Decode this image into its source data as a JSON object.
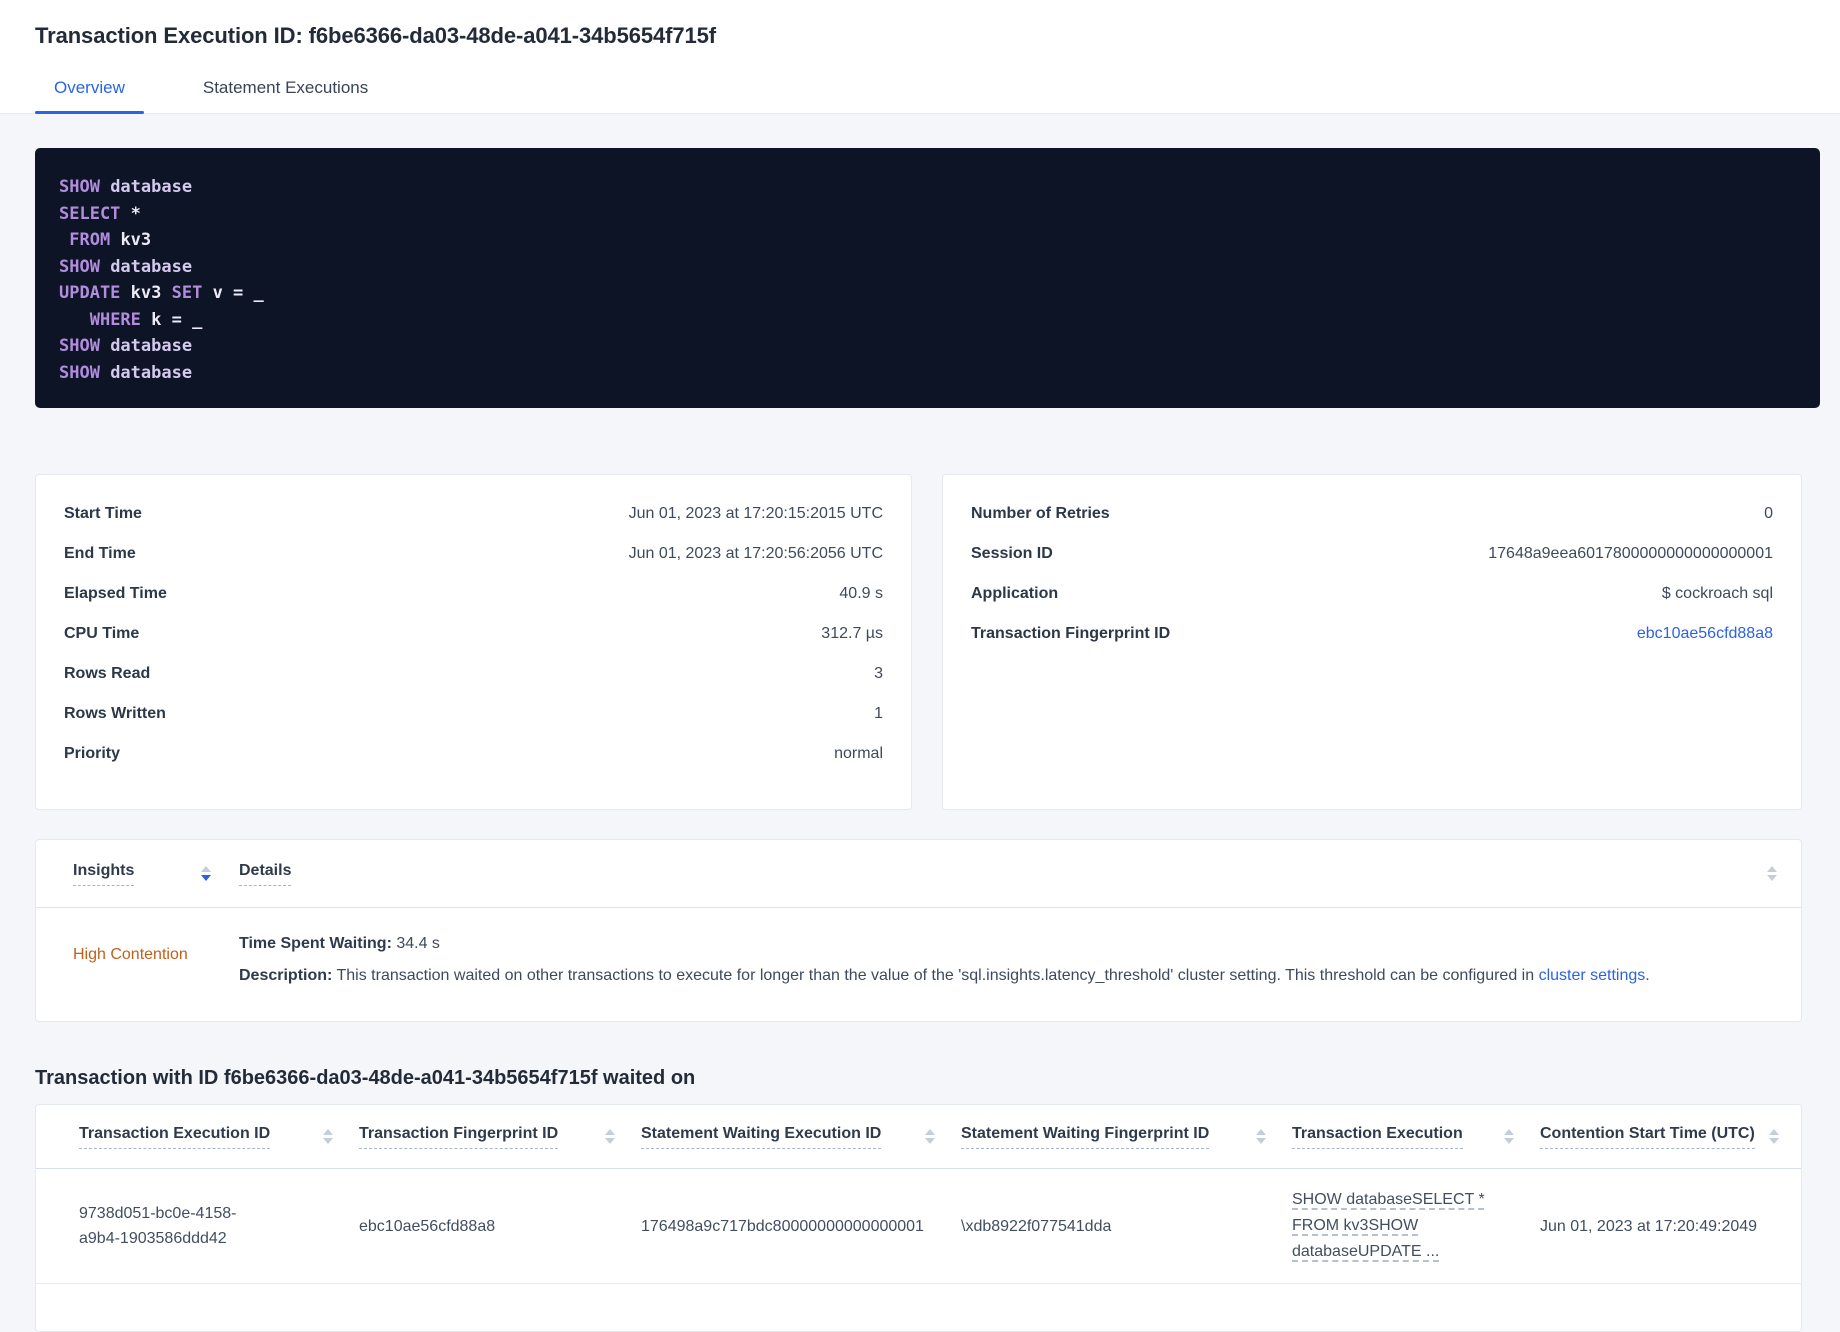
{
  "page": {
    "title": "Transaction Execution ID: f6be6366-da03-48de-a041-34b5654f715f"
  },
  "tabs": {
    "overview": "Overview",
    "statement_executions": "Statement Executions"
  },
  "sql": {
    "lines": [
      [
        {
          "c": "kw",
          "v": "SHOW"
        },
        {
          "c": "pl",
          "v": " database"
        }
      ],
      [
        {
          "c": "kw",
          "v": "SELECT"
        },
        {
          "c": "wh",
          "v": " *"
        }
      ],
      [
        {
          "c": "wh",
          "v": " "
        },
        {
          "c": "kw",
          "v": "FROM"
        },
        {
          "c": "wh",
          "v": " kv3"
        }
      ],
      [
        {
          "c": "kw",
          "v": "SHOW"
        },
        {
          "c": "pl",
          "v": " database"
        }
      ],
      [
        {
          "c": "kw",
          "v": "UPDATE"
        },
        {
          "c": "wh",
          "v": " kv3 "
        },
        {
          "c": "kw",
          "v": "SET"
        },
        {
          "c": "wh",
          "v": " v = _"
        }
      ],
      [
        {
          "c": "wh",
          "v": "   "
        },
        {
          "c": "kw",
          "v": "WHERE"
        },
        {
          "c": "wh",
          "v": " k = _"
        }
      ],
      [
        {
          "c": "kw",
          "v": "SHOW"
        },
        {
          "c": "pl",
          "v": " database"
        }
      ],
      [
        {
          "c": "kw",
          "v": "SHOW"
        },
        {
          "c": "pl",
          "v": " database"
        }
      ]
    ]
  },
  "summary_left": {
    "rows": [
      {
        "label": "Start Time",
        "value": "Jun 01, 2023 at 17:20:15:2015 UTC"
      },
      {
        "label": "End Time",
        "value": "Jun 01, 2023 at 17:20:56:2056 UTC"
      },
      {
        "label": "Elapsed Time",
        "value": "40.9 s"
      },
      {
        "label": "CPU Time",
        "value": "312.7 µs"
      },
      {
        "label": "Rows Read",
        "value": "3"
      },
      {
        "label": "Rows Written",
        "value": "1"
      },
      {
        "label": "Priority",
        "value": "normal"
      }
    ]
  },
  "summary_right": {
    "rows": [
      {
        "label": "Number of Retries",
        "value": "0"
      },
      {
        "label": "Session ID",
        "value": "17648a9eea6017800000000000000001"
      },
      {
        "label": "Application",
        "value": "$ cockroach sql"
      },
      {
        "label": "Transaction Fingerprint ID",
        "value": "ebc10ae56cfd88a8"
      }
    ]
  },
  "insights": {
    "columns": {
      "insights": "Insights",
      "details": "Details"
    },
    "row": {
      "insight": "High Contention",
      "waiting_label": "Time Spent Waiting:",
      "waiting_value": "34.4 s",
      "description_label": "Description:",
      "description_text": "This transaction waited on other transactions to execute for longer than the value of the 'sql.insights.latency_threshold' cluster setting. This threshold can be configured in ",
      "description_link": "cluster settings",
      "description_suffix": "."
    }
  },
  "waited": {
    "heading": "Transaction with ID f6be6366-da03-48de-a041-34b5654f715f waited on",
    "columns": [
      "Transaction Execution ID",
      "Transaction Fingerprint ID",
      "Statement Waiting Execution ID",
      "Statement Waiting Fingerprint ID",
      "Transaction Execution",
      "Contention Start Time (UTC)"
    ],
    "row": {
      "transaction_execution_id": "9738d051-bc0e-4158-a9b4-1903586ddd42",
      "transaction_fingerprint_id": "ebc10ae56cfd88a8",
      "statement_waiting_execution_id": "176498a9c717bdc80000000000000001",
      "statement_waiting_fingerprint_id": "\\xdb8922f077541dda",
      "transaction_execution_preview": "SHOW databaseSELECT * FROM kv3SHOW databaseUPDATE ...",
      "contention_start_time": "Jun 01, 2023 at 17:20:49:2049"
    }
  },
  "colors": {
    "accent_blue": "#2a63e4",
    "warning_orange": "#c2601a",
    "code_background": "#0d1426",
    "code_keyword": "#b28dde",
    "code_text": "#eeebf8"
  }
}
